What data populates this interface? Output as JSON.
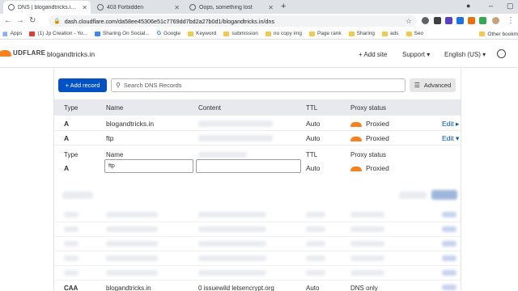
{
  "browser": {
    "tabs": [
      {
        "title": "DNS | blogandtricks.in | Account",
        "active": true
      },
      {
        "title": "403 Forbidden",
        "active": false
      },
      {
        "title": "Oops, something lost",
        "active": false
      }
    ],
    "url": "dash.cloudflare.com/da58ee45306e51c7769dd7bd2a27b0d1/blogandtricks.in/dns",
    "bookmarks": [
      "Apps",
      "(1) Jp Creation - Yo...",
      "Sharing On Social...",
      "Google",
      "Keyword",
      "submission",
      "no copy img",
      "Page rank",
      "Sharing",
      "ads",
      "Seo"
    ],
    "other_bookmarks": "Other bookm"
  },
  "header": {
    "logo_text": "UDFLARE",
    "site": "blogandtricks.in",
    "add_site": "+ Add site",
    "support": "Support ▾",
    "language": "English (US) ▾"
  },
  "toolbar": {
    "add_record": "+ Add record",
    "search_placeholder": "Search DNS Records",
    "advanced": "Advanced"
  },
  "table": {
    "headers": {
      "type": "Type",
      "name": "Name",
      "content": "Content",
      "ttl": "TTL",
      "proxy": "Proxy status"
    },
    "rows": [
      {
        "type": "A",
        "name": "blogandtricks.in",
        "ttl": "Auto",
        "proxy": "Proxied",
        "edit": "Edit ▸"
      },
      {
        "type": "A",
        "name": "ftp",
        "ttl": "Auto",
        "proxy": "Proxied",
        "edit": "Edit ▾"
      }
    ],
    "edit_panel": {
      "type_label": "Type",
      "name_label": "Name",
      "ttl_label": "TTL",
      "proxy_label": "Proxy status",
      "type_value": "A",
      "name_value": "ftp",
      "ttl_value": "Auto",
      "proxy_value": "Proxied"
    },
    "last_row": {
      "type": "CAA",
      "name": "blogandtricks.in",
      "content": "0 issuewild letsencrypt.org",
      "ttl": "Auto",
      "proxy": "DNS only"
    }
  },
  "colors": {
    "accent_blue": "#0051c3",
    "cloudflare_orange": "#f6821f",
    "header_bg": "#e8e8ef"
  }
}
